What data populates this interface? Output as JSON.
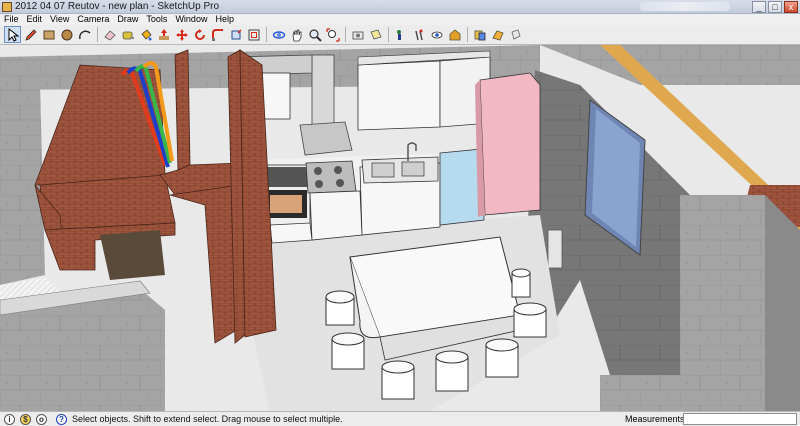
{
  "window": {
    "title": "2012 04 07 Reutov - new plan - SketchUp Pro",
    "buttons": {
      "minimize": "_",
      "maximize": "□",
      "close": "x"
    }
  },
  "menu": {
    "items": [
      "File",
      "Edit",
      "View",
      "Camera",
      "Draw",
      "Tools",
      "Window",
      "Help"
    ]
  },
  "toolbar": {
    "tools": [
      {
        "name": "select-tool",
        "icon": "arrow-icon",
        "active": true
      },
      {
        "name": "pencil-tool",
        "icon": "pencil-icon"
      },
      {
        "name": "rectangle-tool",
        "icon": "rectangle-icon"
      },
      {
        "name": "circle-tool",
        "icon": "circle-icon"
      },
      {
        "name": "arc-tool",
        "icon": "arc-icon"
      },
      {
        "name": "eraser-tool",
        "icon": "eraser-icon"
      },
      {
        "name": "tape-measure-tool",
        "icon": "tape-icon"
      },
      {
        "name": "paint-bucket-tool",
        "icon": "bucket-icon"
      },
      {
        "name": "push-pull-tool",
        "icon": "pushpull-icon"
      },
      {
        "name": "move-tool",
        "icon": "move-icon"
      },
      {
        "name": "rotate-tool",
        "icon": "rotate-icon"
      },
      {
        "name": "follow-me-tool",
        "icon": "followme-icon"
      },
      {
        "name": "scale-tool",
        "icon": "scale-icon"
      },
      {
        "name": "offset-tool",
        "icon": "offset-icon"
      },
      {
        "name": "orbit-tool",
        "icon": "orbit-icon"
      },
      {
        "name": "pan-tool",
        "icon": "hand-icon"
      },
      {
        "name": "zoom-tool",
        "icon": "zoom-icon"
      },
      {
        "name": "zoom-extents-tool",
        "icon": "zoom-extents-icon"
      },
      {
        "name": "position-camera-tool",
        "icon": "camera-icon"
      },
      {
        "name": "section-plane-tool",
        "icon": "section-icon"
      },
      {
        "name": "component-tool",
        "icon": "component-icon"
      },
      {
        "name": "walk-tool",
        "icon": "walk-icon"
      },
      {
        "name": "look-around-tool",
        "icon": "look-icon"
      },
      {
        "name": "warehouse-tool",
        "icon": "warehouse-icon"
      },
      {
        "name": "share-model-tool",
        "icon": "share-icon"
      },
      {
        "name": "extension-tool",
        "icon": "extension-icon"
      },
      {
        "name": "3d-text-tool",
        "icon": "text3d-icon"
      }
    ]
  },
  "status": {
    "hint": "Select objects. Shift to extend select. Drag mouse to select multiple.",
    "measurements_label": "Measurements",
    "measurements_value": ""
  },
  "colors": {
    "brick": "#a0563e",
    "concrete": "#9c9c9c",
    "fridge": "#f2b8c4",
    "dishwasher": "#b7dbee",
    "pipe_red": "#e23a1c",
    "pipe_blue": "#1e3fc9",
    "pipe_green": "#39b54a",
    "pipe_orange": "#f39a1a"
  }
}
